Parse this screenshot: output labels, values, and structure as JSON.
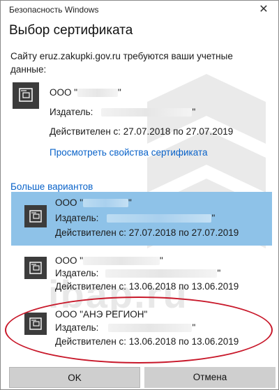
{
  "window": {
    "title": "Безопасность Windows"
  },
  "dialog": {
    "heading": "Выбор сертификата",
    "prompt": "Сайту eruz.zakupki.gov.ru требуются ваши учетные данные:"
  },
  "primary_cert": {
    "org_prefix": "ООО \"",
    "org_suffix": "\"",
    "issuer_label": "Издатель:",
    "issuer_suffix": "\"",
    "validity": "Действителен с: 27.07.2018 по 27.07.2019",
    "properties_link": "Просмотреть свойства сертификата"
  },
  "more_options_label": "Больше вариантов",
  "options": [
    {
      "org_prefix": "ООО \"",
      "org_suffix": "\"",
      "issuer_label": "Издатель:",
      "issuer_suffix": "\"",
      "validity": "Действителен с: 27.07.2018 по 27.07.2019"
    },
    {
      "org_prefix": "ООО \"",
      "org_suffix": "\"",
      "issuer_label": "Издатель:",
      "issuer_suffix": "\"",
      "validity": "Действителен с: 13.06.2018 по 13.06.2019"
    },
    {
      "org": "ООО \"АНЭ РЕГИОН\"",
      "issuer_label": "Издатель:",
      "issuer_suffix": "\"",
      "validity": "Действителен с: 13.06.2018 по 13.06.2019"
    }
  ],
  "watermark": "ibap.ru",
  "buttons": {
    "ok": "OK",
    "cancel": "Отмена"
  },
  "colors": {
    "selected_bg": "#8ec2e8",
    "link": "#0a63c9",
    "highlight_ellipse": "#c8182a",
    "button_bg": "#cfcfcf"
  }
}
